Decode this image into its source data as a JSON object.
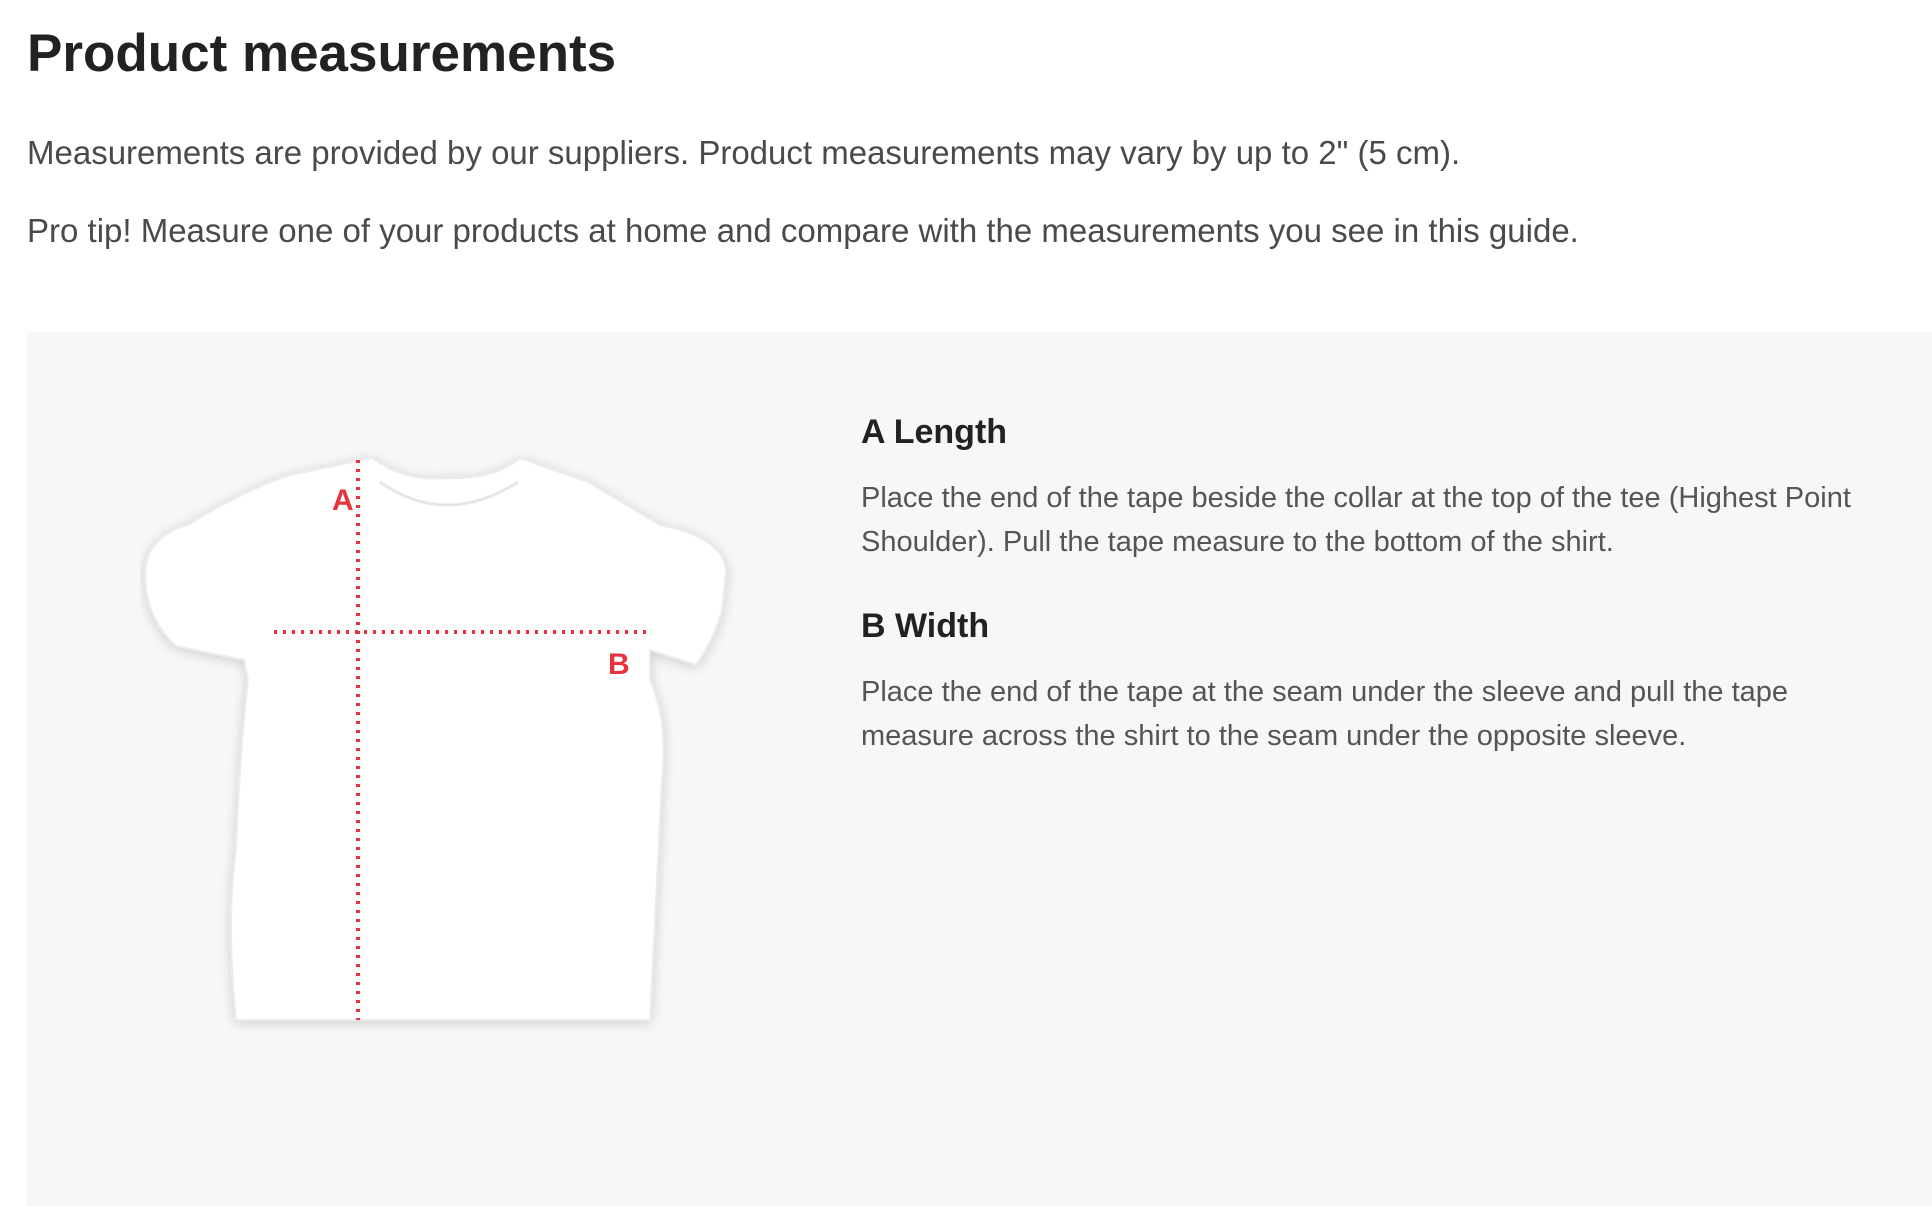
{
  "page": {
    "title": "Product measurements",
    "intro": [
      "Measurements are provided by our suppliers. Product measurements may vary by up to 2\" (5 cm).",
      "Pro tip! Measure one of your products at home and compare with the measurements you see in this guide."
    ]
  },
  "diagram": {
    "label_a": "A",
    "label_b": "B",
    "line_color": "#e8323c",
    "shirt_color": "#ffffff"
  },
  "measurements": [
    {
      "heading": "A Length",
      "description": "Place the end of the tape beside the collar at the top of the tee (Highest Point Shoulder). Pull the tape measure to the bottom of the shirt."
    },
    {
      "heading": "B Width",
      "description": "Place the end of the tape at the seam under the sleeve and pull the tape measure across the shirt to the seam under the opposite sleeve."
    }
  ],
  "colors": {
    "panel_background": "#f7f7f7",
    "heading_text": "#222222",
    "body_text": "#555555"
  }
}
